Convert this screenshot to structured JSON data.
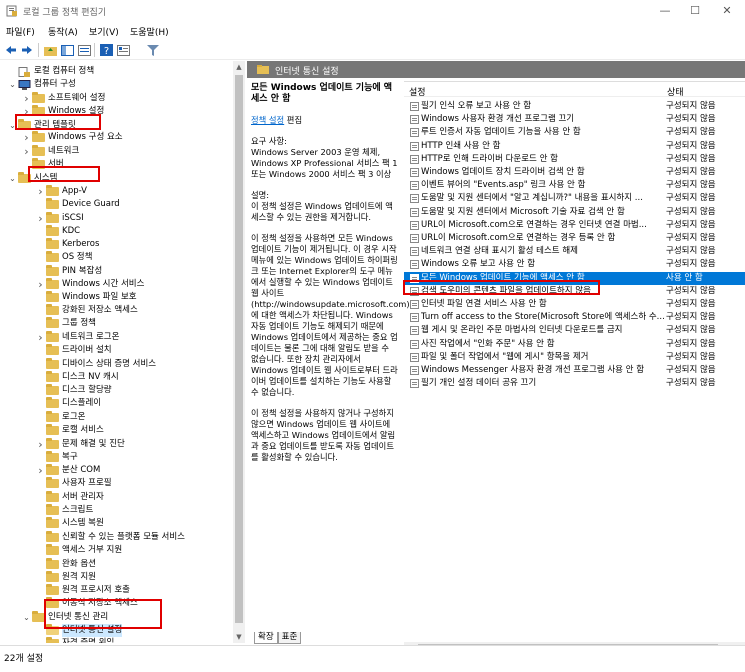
{
  "window": {
    "title": "로컬 그룹 정책 편집기",
    "minimize": "—",
    "maximize": "☐",
    "close": "✕"
  },
  "menu": [
    "파일(F)",
    "동작(A)",
    "보기(V)",
    "도움말(H)"
  ],
  "toolbar": [
    "back-icon",
    "forward-icon",
    "up-folder-icon",
    "show-tree-icon",
    "export-icon",
    "help-icon",
    "properties-icon",
    "filter-icon"
  ],
  "tree": {
    "items": [
      {
        "label": "로컬 컴퓨터 정책",
        "level": 0,
        "expanded": null,
        "icon": "policy"
      },
      {
        "label": "컴퓨터 구성",
        "level": 0,
        "expanded": true,
        "icon": "computer"
      },
      {
        "label": "소프트웨어 설정",
        "level": 2,
        "expanded": false,
        "icon": "folder"
      },
      {
        "label": "Windows 설정",
        "level": 2,
        "expanded": false,
        "icon": "folder"
      },
      {
        "label": "관리 템플릿",
        "level": 1,
        "expanded": true,
        "icon": "folder"
      },
      {
        "label": "Windows 구성 요소",
        "level": 2,
        "expanded": false,
        "icon": "folder"
      },
      {
        "label": "네트워크",
        "level": 2,
        "expanded": false,
        "icon": "folder"
      },
      {
        "label": "서버",
        "level": 2,
        "expanded": null,
        "icon": "folder"
      },
      {
        "label": "시스템",
        "level": 1,
        "expanded": true,
        "icon": "folder"
      },
      {
        "label": "App-V",
        "level": 3,
        "expanded": false,
        "icon": "folder"
      },
      {
        "label": "Device Guard",
        "level": 3,
        "expanded": null,
        "icon": "folder"
      },
      {
        "label": "iSCSI",
        "level": 3,
        "expanded": false,
        "icon": "folder"
      },
      {
        "label": "KDC",
        "level": 3,
        "expanded": null,
        "icon": "folder"
      },
      {
        "label": "Kerberos",
        "level": 3,
        "expanded": null,
        "icon": "folder"
      },
      {
        "label": "OS 정책",
        "level": 3,
        "expanded": null,
        "icon": "folder"
      },
      {
        "label": "PIN 복잡성",
        "level": 3,
        "expanded": null,
        "icon": "folder"
      },
      {
        "label": "Windows 시간 서비스",
        "level": 3,
        "expanded": false,
        "icon": "folder"
      },
      {
        "label": "Windows 파일 보호",
        "level": 3,
        "expanded": null,
        "icon": "folder"
      },
      {
        "label": "강화된 저장소 액세스",
        "level": 3,
        "expanded": null,
        "icon": "folder"
      },
      {
        "label": "그룹 정책",
        "level": 3,
        "expanded": null,
        "icon": "folder"
      },
      {
        "label": "네트워크 로그온",
        "level": 3,
        "expanded": false,
        "icon": "folder"
      },
      {
        "label": "드라이버 설치",
        "level": 3,
        "expanded": null,
        "icon": "folder"
      },
      {
        "label": "디바이스 상태 증명 서비스",
        "level": 3,
        "expanded": null,
        "icon": "folder"
      },
      {
        "label": "디스크 NV 캐시",
        "level": 3,
        "expanded": null,
        "icon": "folder"
      },
      {
        "label": "디스크 할당량",
        "level": 3,
        "expanded": null,
        "icon": "folder"
      },
      {
        "label": "디스플레이",
        "level": 3,
        "expanded": null,
        "icon": "folder"
      },
      {
        "label": "로그온",
        "level": 3,
        "expanded": null,
        "icon": "folder"
      },
      {
        "label": "로캘 서비스",
        "level": 3,
        "expanded": null,
        "icon": "folder"
      },
      {
        "label": "문제 해결 및 진단",
        "level": 3,
        "expanded": false,
        "icon": "folder"
      },
      {
        "label": "복구",
        "level": 3,
        "expanded": null,
        "icon": "folder"
      },
      {
        "label": "분산 COM",
        "level": 3,
        "expanded": false,
        "icon": "folder"
      },
      {
        "label": "사용자 프로필",
        "level": 3,
        "expanded": null,
        "icon": "folder"
      },
      {
        "label": "서버 관리자",
        "level": 3,
        "expanded": null,
        "icon": "folder"
      },
      {
        "label": "스크립트",
        "level": 3,
        "expanded": null,
        "icon": "folder"
      },
      {
        "label": "시스템 복원",
        "level": 3,
        "expanded": null,
        "icon": "folder"
      },
      {
        "label": "신뢰할 수 있는 플랫폼 모듈 서비스",
        "level": 3,
        "expanded": null,
        "icon": "folder"
      },
      {
        "label": "액세스 거부 지원",
        "level": 3,
        "expanded": null,
        "icon": "folder"
      },
      {
        "label": "완화 옵션",
        "level": 3,
        "expanded": null,
        "icon": "folder"
      },
      {
        "label": "원격 지원",
        "level": 3,
        "expanded": null,
        "icon": "folder"
      },
      {
        "label": "원격 프로시저 호출",
        "level": 3,
        "expanded": null,
        "icon": "folder"
      },
      {
        "label": "이동식 저장소 액세스",
        "level": 3,
        "expanded": null,
        "icon": "folder"
      },
      {
        "label": "인터넷 통신 관리",
        "level": 2,
        "expanded": true,
        "icon": "folder"
      },
      {
        "label": "인터넷 통신 설정",
        "level": 3,
        "expanded": null,
        "icon": "folder-open",
        "selected": true
      },
      {
        "label": "자격 증명 위임",
        "level": 3,
        "expanded": null,
        "icon": "folder"
      }
    ]
  },
  "pane": {
    "header": "인터넷 통신 설정",
    "desc_title": "모든 Windows 업데이트 기능에 액세스 안 함",
    "edit_link": "정책 설정",
    "edit_suffix": " 편집",
    "req_label": "요구 사항:",
    "req_text": "Windows Server 2003 운영 체제, Windows XP Professional 서비스 팩 1 또는 Windows 2000 서비스 팩 3 이상",
    "desc_label": "설명:",
    "desc_text": "이 정책 설정은 Windows 업데이트에 액세스할 수 있는 권한을 제거합니다.",
    "desc_text2": "이 정책 설정을 사용하면 모든 Windows 업데이트 기능이 제거됩니다. 이 경우 시작 메뉴에 있는 Windows 업데이트 하이퍼링크 또는 Internet Explorer의 도구 메뉴에서 실행할 수 있는 Windows 업데이트 웹 사이트(http://windowsupdate.microsoft.com)에 대한 액세스가 차단됩니다. Windows 자동 업데이트 기능도 해제되기 때문에 Windows 업데이트에서 제공하는 중요 업데이트는 물론 그에 대해 알림도 받을 수 없습니다. 또한 장치 관리자에서 Windows 업데이트 웹 사이트로부터 드라이버 업데이트를 설치하는 기능도 사용할 수 없습니다.",
    "desc_text3": "이 정책 설정을 사용하지 않거나 구성하지 않으면 Windows 업데이트 웹 사이트에 액세스하고 Windows 업데이트에서 알림과 중요 업데이트를 받도록 자동 업데이트를 활성화할 수 있습니다.",
    "col_setting": "설정",
    "col_state": "상태"
  },
  "settings": [
    {
      "label": "필기 인식 오류 보고 사용 안 함",
      "state": "구성되지 않음"
    },
    {
      "label": "Windows 사용자 환경 개선 프로그램 끄기",
      "state": "구성되지 않음"
    },
    {
      "label": "루트 인증서 자동 업데이트 기능을 사용 안 함",
      "state": "구성되지 않음"
    },
    {
      "label": "HTTP 인쇄 사용 안 함",
      "state": "구성되지 않음"
    },
    {
      "label": "HTTP로 인해 드라이버 다운로드 안 함",
      "state": "구성되지 않음"
    },
    {
      "label": "Windows 업데이트 장치 드라이버 검색 안 함",
      "state": "구성되지 않음"
    },
    {
      "label": "이벤트 뷰어의 \"Events.asp\" 링크 사용 안 함",
      "state": "구성되지 않음"
    },
    {
      "label": "도움말 및 지원 센터에서 \"알고 계십니까?\" 내용을 표시하지 ...",
      "state": "구성되지 않음"
    },
    {
      "label": "도움말 및 지원 센터에서 Microsoft 기술 자료 검색 안 함",
      "state": "구성되지 않음"
    },
    {
      "label": "URL이 Microsoft.com으로 연결하는 경우 인터넷 연결 마법...",
      "state": "구성되지 않음"
    },
    {
      "label": "URL이 Microsoft.com으로 연결하는 경우 등록 안 함",
      "state": "구성되지 않음"
    },
    {
      "label": "네트워크 연결 상태 표시기 활성 테스트 해제",
      "state": "구성되지 않음"
    },
    {
      "label": "Windows 오류 보고 사용 안 함",
      "state": "구성되지 않음"
    },
    {
      "label": "모든 Windows 업데이트 기능에 액세스 안 함",
      "state": "사용 안 함",
      "selected": true
    },
    {
      "label": "검색 도우미의 콘텐츠 파일을 업데이트하지 않음",
      "state": "구성되지 않음"
    },
    {
      "label": "인터넷 파일 연결 서비스 사용 안 함",
      "state": "구성되지 않음"
    },
    {
      "label": "Turn off access to the Store(Microsoft Store에 액세스하 수...",
      "state": "구성되지 않음"
    },
    {
      "label": "웹 게시 및 온라인 주문 마법사의 인터넷 다운로드를 금지",
      "state": "구성되지 않음"
    },
    {
      "label": "사진 작업에서 \"인화 주문\" 사용 안 함",
      "state": "구성되지 않음"
    },
    {
      "label": "파일 및 폴더 작업에서 \"웹에 게시\" 항목을 제거",
      "state": "구성되지 않음"
    },
    {
      "label": "Windows Messenger 사용자 환경 개선 프로그램 사용 안 함",
      "state": "구성되지 않음"
    },
    {
      "label": "필기 개인 설정 데이터 공유 끄기",
      "state": "구성되지 않음"
    }
  ],
  "tabs": [
    "확장",
    "표준"
  ],
  "status": "22개 설정"
}
